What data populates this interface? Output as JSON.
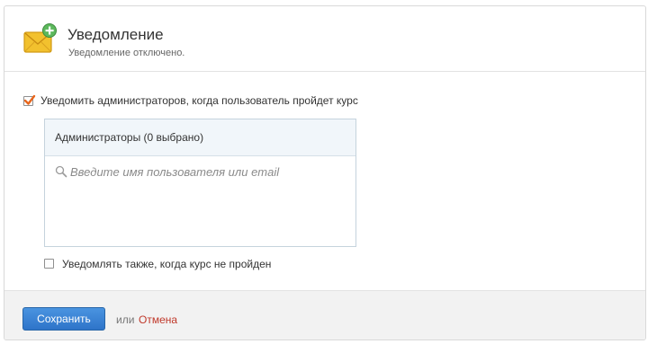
{
  "notification": {
    "title": "Уведомление",
    "subtitle": "Уведомление отключено.",
    "icon": "envelope-add-icon"
  },
  "notify_admins": {
    "label": "Уведомить администраторов, когда пользователь пройдет курс",
    "checked": true
  },
  "admins": {
    "title": "Администраторы (0 выбрано)",
    "search_placeholder": "Введите имя пользователя или email",
    "search_value": ""
  },
  "notify_failed": {
    "label": "Уведомлять также, когда курс не пройден",
    "checked": false
  },
  "footer": {
    "save_label": "Сохранить",
    "or_label": "или",
    "cancel_label": "Отмена"
  },
  "colors": {
    "accent_blue": "#2e74c9",
    "cancel_red": "#c0392b",
    "check_orange": "#e8661c",
    "icon_yellow": "#f2c12e",
    "icon_green": "#5cb85c"
  }
}
